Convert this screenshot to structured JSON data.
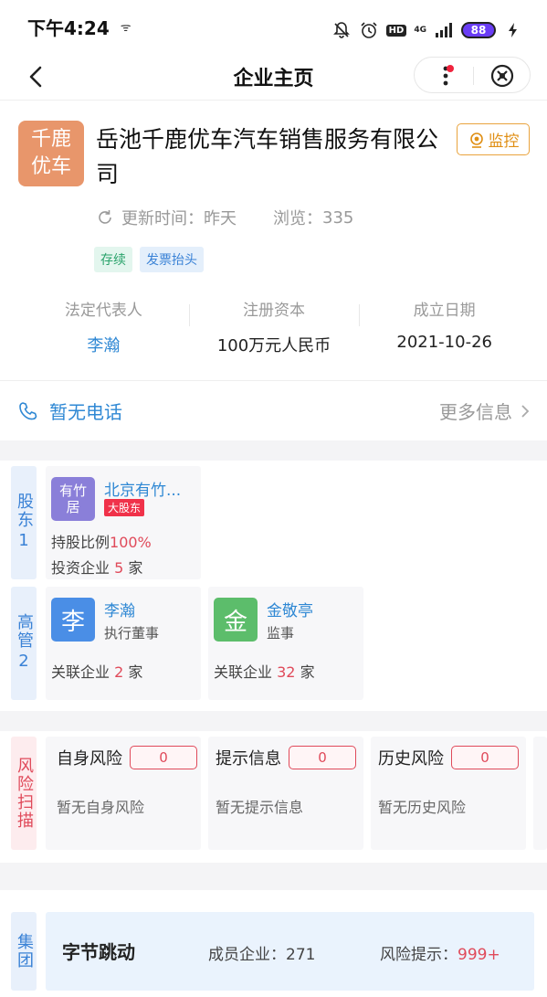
{
  "status": {
    "time": "下午4:24",
    "nfc_glyph": "ᯤ",
    "hd": "HD",
    "network": "4G",
    "battery": "88",
    "icons": [
      "bell-muted-icon",
      "alarm-icon",
      "signal-icon",
      "charging-icon"
    ]
  },
  "nav": {
    "title": "企业主页"
  },
  "company": {
    "logo_line1": "千鹿",
    "logo_line2": "优车",
    "logo_color": "#e8966b",
    "name": "岳池千鹿优车汽车销售服务有限公司",
    "monitor_label": "监控",
    "update_label": "更新时间：",
    "update_value": "昨天",
    "views_label": "浏览：",
    "views_value": "335",
    "tags": [
      "存续",
      "发票抬头"
    ],
    "info": [
      {
        "label": "法定代表人",
        "value": "李瀚"
      },
      {
        "label": "注册资本",
        "value": "100万元人民币"
      },
      {
        "label": "成立日期",
        "value": "2021-10-26"
      }
    ]
  },
  "contact": {
    "phone_text": "暂无电话",
    "more_info": "更多信息"
  },
  "shareholders": {
    "side_label": "股东",
    "side_count": "1",
    "items": [
      {
        "avatar_line1": "有竹",
        "avatar_line2": "居",
        "name": "北京有竹...",
        "badge": "大股东",
        "ratio_label": "持股比例",
        "ratio_value": "100%",
        "invest_label": "投资企业",
        "invest_value": "5",
        "invest_unit": "家"
      }
    ]
  },
  "executives": {
    "side_label": "高管",
    "side_count": "2",
    "items": [
      {
        "avatar": "李",
        "avatar_color": "#4a8ee6",
        "name": "李瀚",
        "role": "执行董事",
        "rel_label": "关联企业",
        "rel_value": "2",
        "rel_unit": "家"
      },
      {
        "avatar": "金",
        "avatar_color": "#5cbd6b",
        "name": "金敬亭",
        "role": "监事",
        "rel_label": "关联企业",
        "rel_value": "32",
        "rel_unit": "家"
      }
    ]
  },
  "risk": {
    "side_label": "风险扫描",
    "items": [
      {
        "title": "自身风险",
        "count": "0",
        "desc": "暂无自身风险"
      },
      {
        "title": "提示信息",
        "count": "0",
        "desc": "暂无提示信息"
      },
      {
        "title": "历史风险",
        "count": "0",
        "desc": "暂无历史风险"
      }
    ]
  },
  "group": {
    "side_label": "集团",
    "name": "字节跳动",
    "members_label": "成员企业：",
    "members_value": "271",
    "risk_label": "风险提示：",
    "risk_value": "999+"
  }
}
